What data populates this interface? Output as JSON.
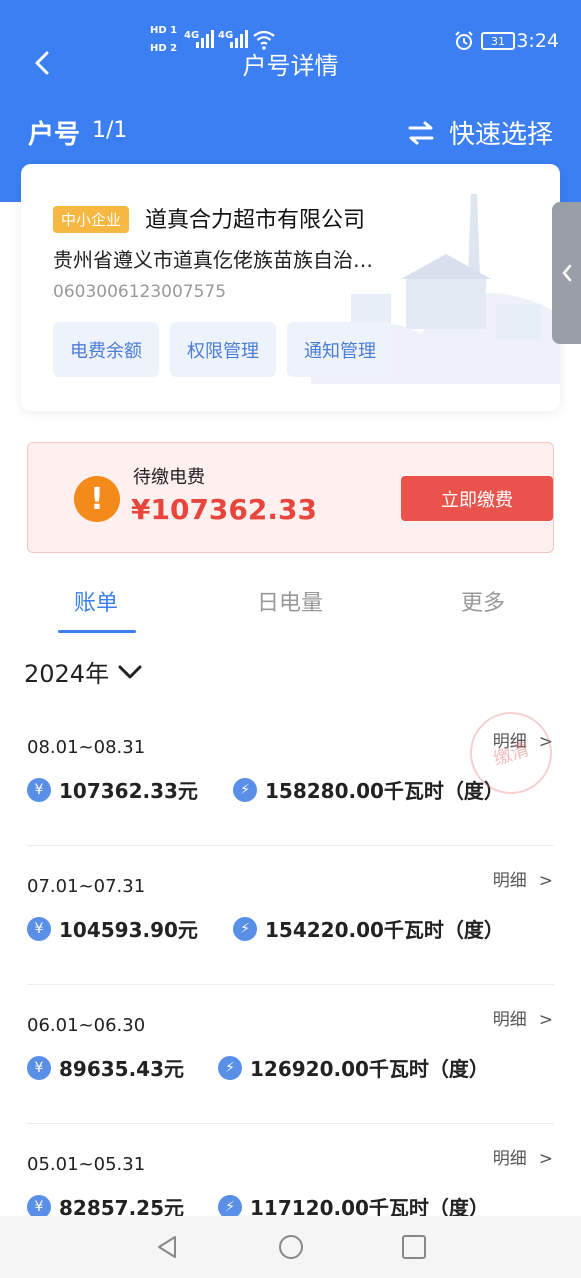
{
  "status_bar": {
    "time": "3:24",
    "battery": "31",
    "sim1_label": "HD 1",
    "sim2_label": "HD 2",
    "net1_label": "4G",
    "net2_label": "4G"
  },
  "header": {
    "title": "户号详情",
    "account_label": "户号",
    "account_count": "1/1",
    "quick_select_label": "快速选择"
  },
  "account_card": {
    "tag": "中小企业",
    "company_name": "道真合力超市有限公司",
    "address": "贵州省遵义市道真仡佬族苗族自治…",
    "account_number": "0603006123007575",
    "buttons": [
      "电费余额",
      "权限管理",
      "通知管理"
    ]
  },
  "payment_due": {
    "label": "待缴电费",
    "amount": "¥107362.33",
    "pay_button": "立即缴费"
  },
  "tabs": [
    {
      "label": "账单",
      "active": true
    },
    {
      "label": "日电量",
      "active": false
    },
    {
      "label": "更多",
      "active": false
    }
  ],
  "year_selector": "2024年",
  "bills": [
    {
      "period": "08.01~08.31",
      "amount": "107362.33元",
      "energy": "158280.00千瓦时（度）",
      "detail": "明细"
    },
    {
      "period": "07.01~07.31",
      "amount": "104593.90元",
      "energy": "154220.00千瓦时（度）",
      "detail": "明细"
    },
    {
      "period": "06.01~06.30",
      "amount": "89635.43元",
      "energy": "126920.00千瓦时（度）",
      "detail": "明细"
    },
    {
      "period": "05.01~05.31",
      "amount": "82857.25元",
      "energy": "117120.00千瓦时（度）",
      "detail": "明细"
    }
  ],
  "stamp_text": "缴清",
  "colors": {
    "primary": "#3b7ff2",
    "danger": "#e8453c",
    "warning": "#f48a1a",
    "tag": "#f6b840"
  }
}
